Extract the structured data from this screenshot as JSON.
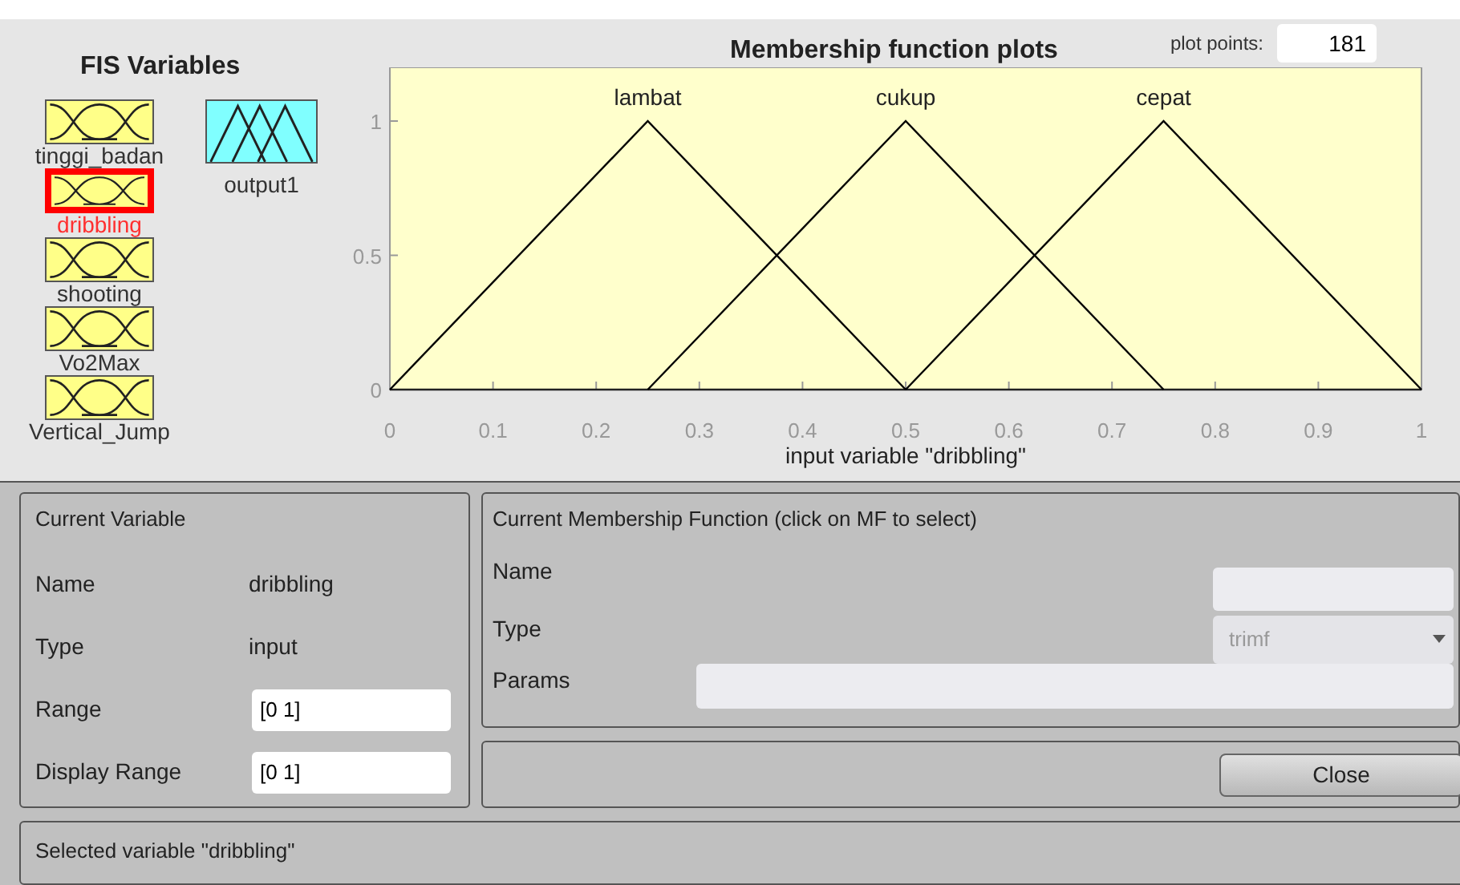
{
  "fis_variables": {
    "title": "FIS Variables",
    "variables": [
      {
        "name": "tinggi_badan",
        "kind": "input",
        "selected": false
      },
      {
        "name": "dribbling",
        "kind": "input",
        "selected": true
      },
      {
        "name": "shooting",
        "kind": "input",
        "selected": false
      },
      {
        "name": "Vo2Max",
        "kind": "input",
        "selected": false
      },
      {
        "name": "Vertical_Jump",
        "kind": "input",
        "selected": false
      },
      {
        "name": "output1",
        "kind": "output",
        "selected": false
      }
    ]
  },
  "plot": {
    "title": "Membership function plots",
    "plot_points_label": "plot points:",
    "plot_points": "181",
    "chart_data": {
      "type": "line",
      "xlabel": "input variable \"dribbling\"",
      "x": [
        0,
        0.25,
        0.5,
        0.75,
        1
      ],
      "series": [
        {
          "name": "lambat",
          "color": "#000000",
          "values": [
            0,
            1,
            0,
            null,
            null
          ]
        },
        {
          "name": "cukup",
          "color": "#000000",
          "values": [
            null,
            0,
            1,
            0,
            null
          ]
        },
        {
          "name": "cepat",
          "color": "#000000",
          "values": [
            null,
            null,
            0,
            1,
            0
          ]
        }
      ],
      "xlim": [
        0,
        1
      ],
      "ylim": [
        0,
        1.2
      ],
      "xticks": [
        {
          "value": 0,
          "label": "0"
        },
        {
          "value": 0.1,
          "label": "0.1"
        },
        {
          "value": 0.2,
          "label": "0.2"
        },
        {
          "value": 0.3,
          "label": "0.3"
        },
        {
          "value": 0.4,
          "label": "0.4"
        },
        {
          "value": 0.5,
          "label": "0.5"
        },
        {
          "value": 0.6,
          "label": "0.6"
        },
        {
          "value": 0.7,
          "label": "0.7"
        },
        {
          "value": 0.8,
          "label": "0.8"
        },
        {
          "value": 0.9,
          "label": "0.9"
        },
        {
          "value": 1,
          "label": "1"
        }
      ],
      "yticks": [
        {
          "value": 0,
          "label": "0"
        },
        {
          "value": 0.5,
          "label": "0.5"
        },
        {
          "value": 1,
          "label": "1"
        }
      ]
    }
  },
  "current_variable": {
    "title": "Current Variable",
    "rows": [
      {
        "label": "Name",
        "value": "dribbling",
        "kind": "text"
      },
      {
        "label": "Type",
        "value": "input",
        "kind": "text"
      },
      {
        "label": "Range",
        "value": "[0 1]",
        "kind": "field"
      },
      {
        "label": "Display Range",
        "value": "[0 1]",
        "kind": "field"
      }
    ]
  },
  "current_mf": {
    "title": "Current Membership Function (click on MF to select)",
    "name_label": "Name",
    "type_label": "Type",
    "type_value": "trimf",
    "params_label": "Params"
  },
  "close_button": "Close",
  "status": "Selected variable \"dribbling\""
}
